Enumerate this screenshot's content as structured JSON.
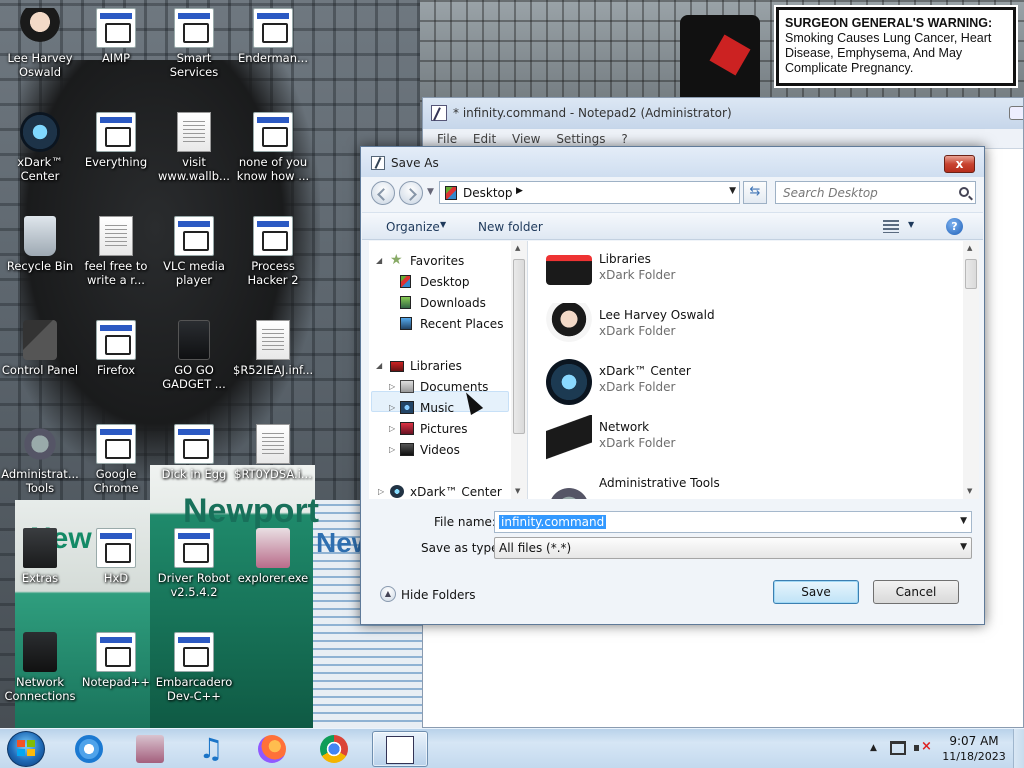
{
  "wallpaper": {
    "warning_bold": "SURGEON GENERAL'S WARNING:",
    "warning_text": "Smoking Causes Lung Cancer, Heart Disease, Emphysema, And May Complicate Pregnancy.",
    "brand_left": "New",
    "brand_center": "Newport",
    "brand_right": "New"
  },
  "desktop_icons": [
    {
      "label": "Lee Harvey Oswald",
      "icon": "character-icon"
    },
    {
      "label": "AIMP",
      "icon": "aimp-icon"
    },
    {
      "label": "Smart Services",
      "icon": "gear-icon"
    },
    {
      "label": "Enderman...",
      "icon": "app-icon"
    },
    {
      "label": "xDark™ Center",
      "icon": "xdark-icon"
    },
    {
      "label": "Everything",
      "icon": "search-icon"
    },
    {
      "label": "visit www.wallb...",
      "icon": "document-icon"
    },
    {
      "label": "none of you know how ...",
      "icon": "app-icon"
    },
    {
      "label": "Recycle Bin",
      "icon": "recycle-bin-icon"
    },
    {
      "label": "feel free to write a r...",
      "icon": "document-icon"
    },
    {
      "label": "VLC media player",
      "icon": "vlc-icon"
    },
    {
      "label": "Process Hacker 2",
      "icon": "process-hacker-icon"
    },
    {
      "label": "Control Panel",
      "icon": "control-panel-icon"
    },
    {
      "label": "Firefox",
      "icon": "firefox-icon"
    },
    {
      "label": "GO GO GADGET ...",
      "icon": "gadget-icon"
    },
    {
      "label": "$R52IEAJ.inf...",
      "icon": "settings-file-icon"
    },
    {
      "label": "Administrat... Tools",
      "icon": "admin-tools-icon"
    },
    {
      "label": "Google Chrome",
      "icon": "chrome-icon"
    },
    {
      "label": "Dick in Egg",
      "icon": "app-icon"
    },
    {
      "label": "$RT0YDSA.i...",
      "icon": "settings-file-icon"
    },
    {
      "label": "Extras",
      "icon": "folder-icon"
    },
    {
      "label": "HxD",
      "icon": "hxd-icon"
    },
    {
      "label": "Driver Robot v2.5.4.2",
      "icon": "driver-robot-icon"
    },
    {
      "label": "explorer.exe",
      "icon": "explorer-icon"
    },
    {
      "label": "Network Connections",
      "icon": "network-icon"
    },
    {
      "label": "Notepad++",
      "icon": "notepad-plus-icon"
    },
    {
      "label": "Embarcadero Dev-C++",
      "icon": "devcpp-icon"
    }
  ],
  "notepad": {
    "title": "* infinity.command - Notepad2 (Administrator)",
    "menu": [
      "File",
      "Edit",
      "View",
      "Settings",
      "?"
    ]
  },
  "save_as": {
    "title": "Save As",
    "close_glyph": "x",
    "address": "Desktop",
    "search_placeholder": "Search Desktop",
    "organize": "Organize",
    "new_folder": "New folder",
    "help_glyph": "?",
    "tree": {
      "favorites": "Favorites",
      "desktop": "Desktop",
      "downloads": "Downloads",
      "recent_places": "Recent Places",
      "libraries": "Libraries",
      "documents": "Documents",
      "music": "Music",
      "pictures": "Pictures",
      "videos": "Videos",
      "xdark_center": "xDark™ Center"
    },
    "files": [
      {
        "name": "Libraries",
        "type": "xDark Folder"
      },
      {
        "name": "Lee Harvey Oswald",
        "type": "xDark Folder"
      },
      {
        "name": "xDark™ Center",
        "type": "xDark Folder"
      },
      {
        "name": "Network",
        "type": "xDark Folder"
      },
      {
        "name": "Administrative Tools",
        "type": ""
      }
    ],
    "file_name_label": "File name:",
    "file_name_value": "infinity.command",
    "save_as_type_label": "Save as type:",
    "save_as_type_value": "All files (*.*)",
    "hide_folders": "Hide Folders",
    "save_button": "Save",
    "cancel_button": "Cancel"
  },
  "taskbar": {
    "pinned": [
      "internet-explorer-icon",
      "app-icon",
      "music-icon",
      "firefox-icon",
      "chrome-icon",
      "notepad2-icon"
    ],
    "clock_time": "9:07 AM",
    "clock_date": "11/18/2023"
  }
}
